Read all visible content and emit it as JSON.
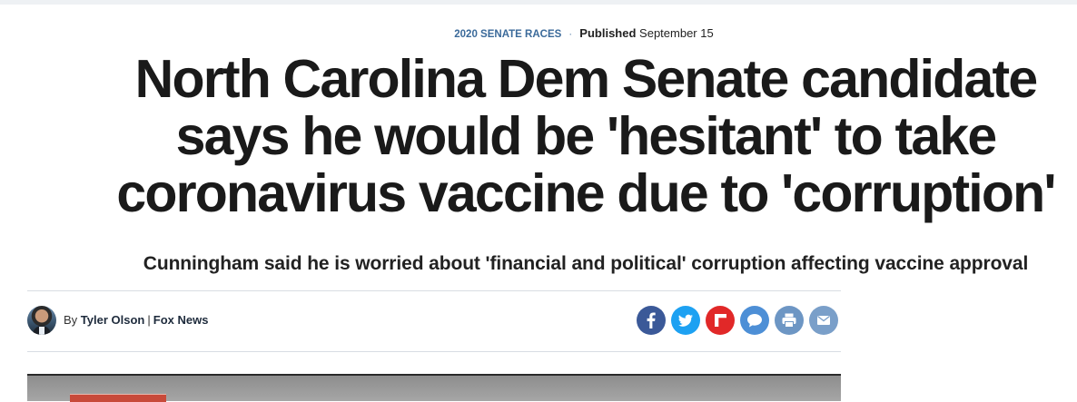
{
  "eyebrow": {
    "category": "2020 SENATE RACES",
    "separator": "·",
    "published_label": "Published",
    "published_date": "September 15"
  },
  "article": {
    "headline": "North Carolina Dem Senate candidate says he would be 'hesitant' to take coronavirus vaccine due to 'corruption'",
    "subheadline": "Cunningham said he is worried about 'financial and political' corruption affecting vaccine approval"
  },
  "byline": {
    "prefix": "By",
    "author": "Tyler Olson",
    "separator": "|",
    "outlet": "Fox News"
  },
  "share": {
    "buttons": [
      {
        "icon": "facebook-icon",
        "color": "#3b5998"
      },
      {
        "icon": "twitter-icon",
        "color": "#1da1f2"
      },
      {
        "icon": "flipboard-icon",
        "color": "#e12828"
      },
      {
        "icon": "comment-icon",
        "color": "#4d8fd6"
      },
      {
        "icon": "print-icon",
        "color": "#6d96c4"
      },
      {
        "icon": "email-icon",
        "color": "#7a9fc9"
      }
    ]
  }
}
